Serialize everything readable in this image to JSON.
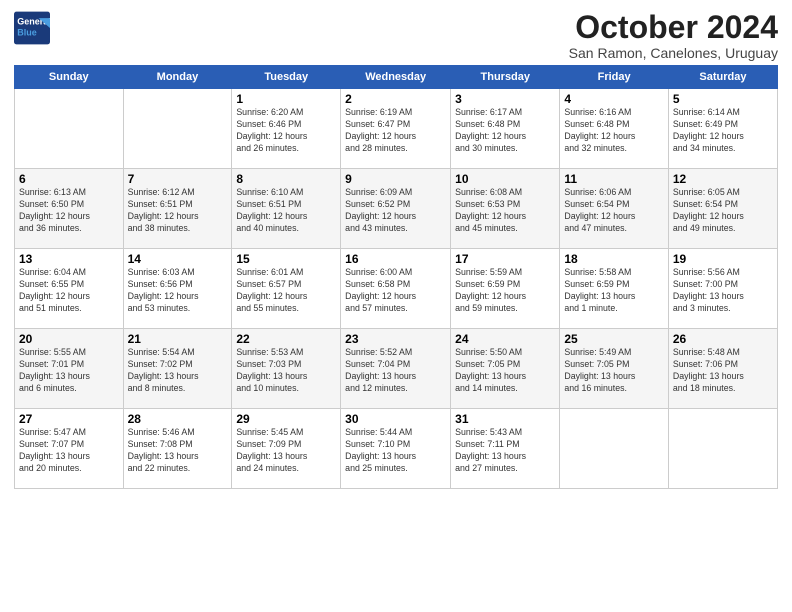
{
  "header": {
    "logo_line1": "General",
    "logo_line2": "Blue",
    "month_title": "October 2024",
    "location": "San Ramon, Canelones, Uruguay"
  },
  "weekdays": [
    "Sunday",
    "Monday",
    "Tuesday",
    "Wednesday",
    "Thursday",
    "Friday",
    "Saturday"
  ],
  "weeks": [
    [
      {
        "day": "",
        "text": ""
      },
      {
        "day": "",
        "text": ""
      },
      {
        "day": "1",
        "text": "Sunrise: 6:20 AM\nSunset: 6:46 PM\nDaylight: 12 hours\nand 26 minutes."
      },
      {
        "day": "2",
        "text": "Sunrise: 6:19 AM\nSunset: 6:47 PM\nDaylight: 12 hours\nand 28 minutes."
      },
      {
        "day": "3",
        "text": "Sunrise: 6:17 AM\nSunset: 6:48 PM\nDaylight: 12 hours\nand 30 minutes."
      },
      {
        "day": "4",
        "text": "Sunrise: 6:16 AM\nSunset: 6:48 PM\nDaylight: 12 hours\nand 32 minutes."
      },
      {
        "day": "5",
        "text": "Sunrise: 6:14 AM\nSunset: 6:49 PM\nDaylight: 12 hours\nand 34 minutes."
      }
    ],
    [
      {
        "day": "6",
        "text": "Sunrise: 6:13 AM\nSunset: 6:50 PM\nDaylight: 12 hours\nand 36 minutes."
      },
      {
        "day": "7",
        "text": "Sunrise: 6:12 AM\nSunset: 6:51 PM\nDaylight: 12 hours\nand 38 minutes."
      },
      {
        "day": "8",
        "text": "Sunrise: 6:10 AM\nSunset: 6:51 PM\nDaylight: 12 hours\nand 40 minutes."
      },
      {
        "day": "9",
        "text": "Sunrise: 6:09 AM\nSunset: 6:52 PM\nDaylight: 12 hours\nand 43 minutes."
      },
      {
        "day": "10",
        "text": "Sunrise: 6:08 AM\nSunset: 6:53 PM\nDaylight: 12 hours\nand 45 minutes."
      },
      {
        "day": "11",
        "text": "Sunrise: 6:06 AM\nSunset: 6:54 PM\nDaylight: 12 hours\nand 47 minutes."
      },
      {
        "day": "12",
        "text": "Sunrise: 6:05 AM\nSunset: 6:54 PM\nDaylight: 12 hours\nand 49 minutes."
      }
    ],
    [
      {
        "day": "13",
        "text": "Sunrise: 6:04 AM\nSunset: 6:55 PM\nDaylight: 12 hours\nand 51 minutes."
      },
      {
        "day": "14",
        "text": "Sunrise: 6:03 AM\nSunset: 6:56 PM\nDaylight: 12 hours\nand 53 minutes."
      },
      {
        "day": "15",
        "text": "Sunrise: 6:01 AM\nSunset: 6:57 PM\nDaylight: 12 hours\nand 55 minutes."
      },
      {
        "day": "16",
        "text": "Sunrise: 6:00 AM\nSunset: 6:58 PM\nDaylight: 12 hours\nand 57 minutes."
      },
      {
        "day": "17",
        "text": "Sunrise: 5:59 AM\nSunset: 6:59 PM\nDaylight: 12 hours\nand 59 minutes."
      },
      {
        "day": "18",
        "text": "Sunrise: 5:58 AM\nSunset: 6:59 PM\nDaylight: 13 hours\nand 1 minute."
      },
      {
        "day": "19",
        "text": "Sunrise: 5:56 AM\nSunset: 7:00 PM\nDaylight: 13 hours\nand 3 minutes."
      }
    ],
    [
      {
        "day": "20",
        "text": "Sunrise: 5:55 AM\nSunset: 7:01 PM\nDaylight: 13 hours\nand 6 minutes."
      },
      {
        "day": "21",
        "text": "Sunrise: 5:54 AM\nSunset: 7:02 PM\nDaylight: 13 hours\nand 8 minutes."
      },
      {
        "day": "22",
        "text": "Sunrise: 5:53 AM\nSunset: 7:03 PM\nDaylight: 13 hours\nand 10 minutes."
      },
      {
        "day": "23",
        "text": "Sunrise: 5:52 AM\nSunset: 7:04 PM\nDaylight: 13 hours\nand 12 minutes."
      },
      {
        "day": "24",
        "text": "Sunrise: 5:50 AM\nSunset: 7:05 PM\nDaylight: 13 hours\nand 14 minutes."
      },
      {
        "day": "25",
        "text": "Sunrise: 5:49 AM\nSunset: 7:05 PM\nDaylight: 13 hours\nand 16 minutes."
      },
      {
        "day": "26",
        "text": "Sunrise: 5:48 AM\nSunset: 7:06 PM\nDaylight: 13 hours\nand 18 minutes."
      }
    ],
    [
      {
        "day": "27",
        "text": "Sunrise: 5:47 AM\nSunset: 7:07 PM\nDaylight: 13 hours\nand 20 minutes."
      },
      {
        "day": "28",
        "text": "Sunrise: 5:46 AM\nSunset: 7:08 PM\nDaylight: 13 hours\nand 22 minutes."
      },
      {
        "day": "29",
        "text": "Sunrise: 5:45 AM\nSunset: 7:09 PM\nDaylight: 13 hours\nand 24 minutes."
      },
      {
        "day": "30",
        "text": "Sunrise: 5:44 AM\nSunset: 7:10 PM\nDaylight: 13 hours\nand 25 minutes."
      },
      {
        "day": "31",
        "text": "Sunrise: 5:43 AM\nSunset: 7:11 PM\nDaylight: 13 hours\nand 27 minutes."
      },
      {
        "day": "",
        "text": ""
      },
      {
        "day": "",
        "text": ""
      }
    ]
  ]
}
